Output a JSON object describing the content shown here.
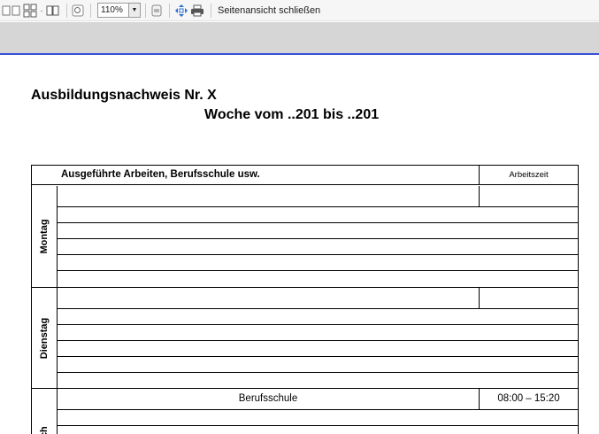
{
  "toolbar": {
    "icons": [
      "single-page-icon",
      "multi-page-icon",
      "two-page-icon",
      "zoom-icon",
      "page-setup-icon",
      "fit-icon",
      "print-icon"
    ],
    "zoom_value": "110%",
    "close_label": "Seitenansicht schließen"
  },
  "document": {
    "title": "Ausbildungsnachweis Nr. X",
    "subtitle": "Woche vom ..201 bis ..201",
    "table": {
      "header_work": "Ausgeführte Arbeiten, Berufsschule usw.",
      "header_time": "Arbeitszeit",
      "days": [
        {
          "label": "Montag",
          "rows": [
            {
              "text": "",
              "time": ""
            },
            {
              "text": "",
              "time": ""
            },
            {
              "text": "",
              "time": ""
            },
            {
              "text": "",
              "time": ""
            },
            {
              "text": "",
              "time": ""
            }
          ]
        },
        {
          "label": "Dienstag",
          "rows": [
            {
              "text": "",
              "time": ""
            },
            {
              "text": "",
              "time": ""
            },
            {
              "text": "",
              "time": ""
            },
            {
              "text": "",
              "time": ""
            },
            {
              "text": "",
              "time": ""
            }
          ]
        },
        {
          "label": "och",
          "rows": [
            {
              "text": "Berufsschule",
              "time": "08:00 – 15:20"
            },
            {
              "text": "",
              "time": ""
            }
          ]
        }
      ]
    }
  },
  "colors": {
    "accent_line": "#3b4fd6",
    "band": "#d6d6d6"
  }
}
